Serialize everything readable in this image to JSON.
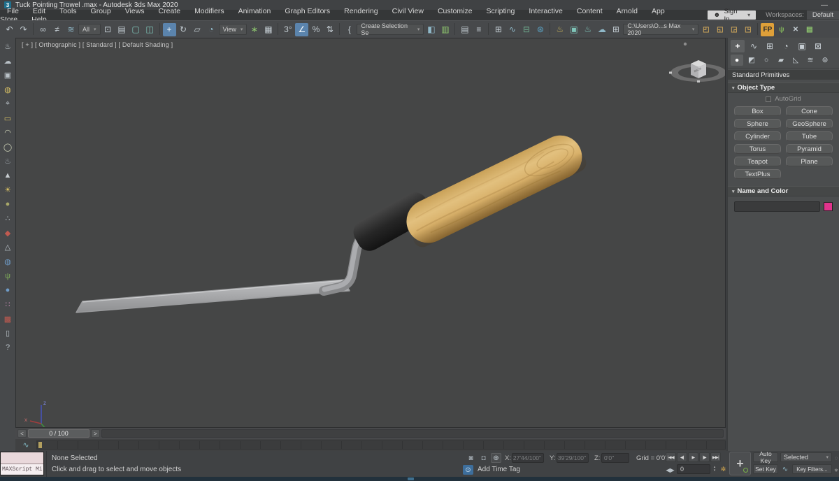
{
  "window": {
    "app_badge": "3",
    "title": "Tuck Pointing Trowel .max - Autodesk 3ds Max 2020",
    "minimize_glyph": "—"
  },
  "ui": {
    "caret": "▾",
    "spin_up": "▴",
    "spin_down": "▾"
  },
  "menu": {
    "items": [
      {
        "name": "menu-file",
        "label": "File"
      },
      {
        "name": "menu-edit",
        "label": "Edit"
      },
      {
        "name": "menu-tools",
        "label": "Tools"
      },
      {
        "name": "menu-group",
        "label": "Group"
      },
      {
        "name": "menu-views",
        "label": "Views"
      },
      {
        "name": "menu-create",
        "label": "Create"
      },
      {
        "name": "menu-modifiers",
        "label": "Modifiers"
      },
      {
        "name": "menu-animation",
        "label": "Animation"
      },
      {
        "name": "menu-graph-editors",
        "label": "Graph Editors"
      },
      {
        "name": "menu-rendering",
        "label": "Rendering"
      },
      {
        "name": "menu-civil-view",
        "label": "Civil View"
      },
      {
        "name": "menu-customize",
        "label": "Customize"
      },
      {
        "name": "menu-scripting",
        "label": "Scripting"
      },
      {
        "name": "menu-interactive",
        "label": "Interactive"
      },
      {
        "name": "menu-content",
        "label": "Content"
      },
      {
        "name": "menu-arnold",
        "label": "Arnold"
      },
      {
        "name": "menu-app-store",
        "label": "App Store"
      },
      {
        "name": "menu-help",
        "label": "Help"
      }
    ],
    "signin_label": "Sign In",
    "workspaces_label": "Workspaces:",
    "workspace_value": "Default"
  },
  "toolbar": {
    "seg1": [
      {
        "name": "undo-icon",
        "glyph": "↶"
      },
      {
        "name": "redo-icon",
        "glyph": "↷"
      },
      {
        "sep": true
      },
      {
        "name": "link-icon",
        "glyph": "∞"
      },
      {
        "name": "unlink-icon",
        "glyph": "≠"
      },
      {
        "name": "bind-spacewarp-icon",
        "glyph": "≋",
        "color": "#8fb8c8"
      }
    ],
    "all_label": "All",
    "seg2": [
      {
        "name": "select-object-icon",
        "glyph": "⊡"
      },
      {
        "name": "select-by-name-icon",
        "glyph": "▤"
      },
      {
        "name": "rect-region-icon",
        "glyph": "▢",
        "color": "#7fc4b8"
      },
      {
        "name": "window-crossing-icon",
        "glyph": "◫",
        "color": "#7fc4b8"
      },
      {
        "sep": true
      },
      {
        "name": "move-icon",
        "glyph": "+",
        "active": true
      },
      {
        "name": "rotate-icon",
        "glyph": "↻"
      },
      {
        "name": "scale-icon",
        "glyph": "▱"
      },
      {
        "name": "placement-icon",
        "glyph": "◔",
        "color": "#8fb8c8"
      }
    ],
    "view_label": "View",
    "seg3": [
      {
        "name": "manipulate-icon",
        "glyph": "∗",
        "color": "#8fc86f"
      },
      {
        "name": "keyboard-override-icon",
        "glyph": "▦"
      },
      {
        "sep": true
      },
      {
        "name": "snap-toggle-icon",
        "glyph": "3°"
      },
      {
        "name": "angle-snap-icon",
        "glyph": "∠",
        "active": true
      },
      {
        "name": "percent-snap-icon",
        "glyph": "%"
      },
      {
        "name": "spinner-snap-icon",
        "glyph": "⇅"
      },
      {
        "sep": true
      },
      {
        "name": "named-selection-icon",
        "glyph": "{"
      }
    ],
    "selset_label": "Create Selection Se",
    "seg4": [
      {
        "name": "mirror-icon",
        "glyph": "◧",
        "color": "#8fb8c8"
      },
      {
        "name": "align-icon",
        "glyph": "▥",
        "color": "#8fc86f"
      },
      {
        "sep": true
      },
      {
        "name": "layer-explorer-icon",
        "glyph": "▤"
      },
      {
        "name": "toggle-layers-icon",
        "glyph": "≡"
      },
      {
        "sep": true
      },
      {
        "name": "graphite-ribbon-icon",
        "glyph": "⊞"
      },
      {
        "name": "curve-editor-icon",
        "glyph": "∿",
        "color": "#8fb8c8"
      },
      {
        "name": "schematic-view-icon",
        "glyph": "⊟",
        "color": "#6fae8f"
      },
      {
        "name": "material-editor-icon",
        "glyph": "⊛",
        "color": "#5aa5c8"
      },
      {
        "sep": true
      },
      {
        "name": "render-setup-icon",
        "glyph": "♨",
        "color": "#c8b25a"
      },
      {
        "name": "rendered-frame-icon",
        "glyph": "▣",
        "color": "#7fc4b8"
      },
      {
        "name": "render-production-icon",
        "glyph": "♨",
        "color": "#7fc4b8"
      },
      {
        "name": "render-cloud-icon",
        "glyph": "☁",
        "color": "#8fb8c8"
      },
      {
        "name": "open-in-viewport-icon",
        "glyph": "⊞"
      }
    ],
    "project_label": "C:\\Users\\O...s Max 2020",
    "seg5": [
      {
        "name": "open-container-icon",
        "glyph": "◰",
        "color": "#c8a25a"
      },
      {
        "name": "save-container-icon",
        "glyph": "◱",
        "color": "#c8a25a"
      },
      {
        "name": "inherit-container-icon",
        "glyph": "◲",
        "color": "#c8a25a"
      },
      {
        "name": "local-container-icon",
        "glyph": "◳",
        "color": "#c8a25a"
      },
      {
        "sep": true
      },
      {
        "name": "populate-icon",
        "glyph": "FP",
        "bg": "#dfa039",
        "color": "#2b2b2b"
      },
      {
        "name": "populate-flow-icon",
        "glyph": "ψ",
        "color": "#7fae5a"
      },
      {
        "name": "customize-tools-icon",
        "glyph": "✕"
      },
      {
        "name": "scene-list-icon",
        "glyph": "▤",
        "color": "#8fc86f"
      }
    ]
  },
  "leftbar": {
    "icons": [
      {
        "name": "render-teapot-icon",
        "glyph": "♨"
      },
      {
        "name": "cloud-icon",
        "glyph": "☁"
      },
      {
        "name": "render-window-icon",
        "glyph": "▣"
      },
      {
        "name": "lamp-icon",
        "glyph": "◍",
        "color": "#d8c064"
      },
      {
        "name": "camera-icon",
        "glyph": "⌖"
      },
      {
        "name": "plane-icon",
        "glyph": "▭",
        "color": "#d8c064"
      },
      {
        "name": "dome-icon",
        "glyph": "◠",
        "color": "#cfd4b8"
      },
      {
        "name": "disc-icon",
        "glyph": "◯",
        "color": "#cfd4b8"
      },
      {
        "name": "teapot-icon",
        "glyph": "♨",
        "color": "#9aa2a8"
      },
      {
        "name": "cone-icon",
        "glyph": "▲",
        "color": "#c8cdd1"
      },
      {
        "name": "sun-icon",
        "glyph": "☀",
        "color": "#d8c064"
      },
      {
        "name": "sphere-olive-icon",
        "glyph": "●",
        "color": "#a8a869"
      },
      {
        "name": "particles-icon",
        "glyph": "∴",
        "color": "#b9c1c7"
      },
      {
        "name": "gem-icon",
        "glyph": "◆",
        "color": "#c05a50"
      },
      {
        "name": "pyramid-icon",
        "glyph": "△"
      },
      {
        "name": "globe-icon",
        "glyph": "◍",
        "color": "#6f9cc8"
      },
      {
        "name": "foliage-icon",
        "glyph": "ψ",
        "color": "#7fae5a"
      },
      {
        "name": "sphere-blue-icon",
        "glyph": "●",
        "color": "#6f9cc8"
      },
      {
        "name": "balls-icon",
        "glyph": "∷",
        "color": "#c08ab0"
      },
      {
        "name": "selection-set-icon",
        "glyph": "▩",
        "color": "#c05a50"
      },
      {
        "name": "clipboard-icon",
        "glyph": "▯"
      },
      {
        "name": "help-icon",
        "glyph": "?"
      }
    ]
  },
  "viewport": {
    "label": "[ + ] [ Orthographic ] [ Standard ] [ Default Shading ]",
    "viewcube_face": "BACK",
    "axis": {
      "x": "x",
      "y": "y",
      "z": "z"
    }
  },
  "command_panel": {
    "tabs": [
      {
        "name": "tab-create",
        "glyph": "+",
        "active": true
      },
      {
        "name": "tab-modify",
        "glyph": "∿"
      },
      {
        "name": "tab-hierarchy",
        "glyph": "⊞"
      },
      {
        "name": "tab-motion",
        "glyph": "◔"
      },
      {
        "name": "tab-display",
        "glyph": "▣"
      },
      {
        "name": "tab-utilities",
        "glyph": "⊠"
      }
    ],
    "categories": [
      {
        "name": "cat-geometry",
        "glyph": "●",
        "active": true
      },
      {
        "name": "cat-shapes",
        "glyph": "◩"
      },
      {
        "name": "cat-lights",
        "glyph": "○"
      },
      {
        "name": "cat-cameras",
        "glyph": "▰"
      },
      {
        "name": "cat-helpers",
        "glyph": "◺"
      },
      {
        "name": "cat-spacewarps",
        "glyph": "≋"
      },
      {
        "name": "cat-systems",
        "glyph": "⊚"
      }
    ],
    "subcategory": "Standard Primitives",
    "object_type": {
      "header": "Object Type",
      "autogrid_label": "AutoGrid",
      "buttons": [
        {
          "name": "box-button",
          "label": "Box"
        },
        {
          "name": "cone-button",
          "label": "Cone"
        },
        {
          "name": "sphere-button",
          "label": "Sphere"
        },
        {
          "name": "geosphere-button",
          "label": "GeoSphere"
        },
        {
          "name": "cylinder-button",
          "label": "Cylinder"
        },
        {
          "name": "tube-button",
          "label": "Tube"
        },
        {
          "name": "torus-button",
          "label": "Torus"
        },
        {
          "name": "pyramid-button",
          "label": "Pyramid"
        },
        {
          "name": "teapot-button",
          "label": "Teapot"
        },
        {
          "name": "plane-button",
          "label": "Plane"
        },
        {
          "name": "textplus-button",
          "label": "TextPlus"
        }
      ]
    },
    "name_color": {
      "header": "Name and Color",
      "name_value": "",
      "swatch_color": "#e0338c"
    }
  },
  "timeline": {
    "prev": "<",
    "slider_label": "0 / 100",
    "next": ">",
    "curve_glyph": "∿"
  },
  "status": {
    "maxscript_label": "MAXScript Mi",
    "selection_status": "None Selected",
    "prompt": "Click and drag to select and move objects",
    "isolate_glyph": "◙",
    "lock_glyph": "◘",
    "coord_mode_glyph": "⊕",
    "coord": {
      "x_label": "X:",
      "x_value": "-27'44/100\"",
      "y_label": "Y:",
      "y_value": "-39'29/100\"",
      "z_label": "Z:",
      "z_value": "0'0\"",
      "grid_label": "Grid = 0'0\""
    },
    "time_tag_glyph": "⊙",
    "time_tag_label": "Add Time Tag",
    "playback": [
      {
        "name": "go-start-button",
        "glyph": "|◀◀"
      },
      {
        "name": "prev-frame-button",
        "glyph": "◀|"
      },
      {
        "name": "play-button",
        "glyph": "▶"
      },
      {
        "name": "next-frame-button",
        "glyph": "|▶"
      },
      {
        "name": "go-end-button",
        "glyph": "▶▶|"
      }
    ],
    "nudge_glyph": "◀▶",
    "frame_value": "0",
    "frame_key_glyph": "✼",
    "bigkey_glyph": "+",
    "auto_key": "Auto Key",
    "set_key": "Set Key",
    "selected_dropdown": "Selected",
    "key_mode_glyph": "∿",
    "key_filters": "Key Filters...",
    "zoom_region_glyph": "◌",
    "pan_glyph": "∗"
  }
}
